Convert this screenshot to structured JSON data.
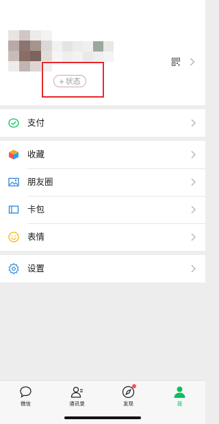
{
  "profile": {
    "status_label": "状态",
    "status_plus": "+",
    "avatar_mosaic": [
      "#e9e4e2",
      "#cfc7c5",
      "#eeeae9",
      "#f5f3f2",
      "#b8aaa7",
      "#8d756f",
      "#a6948f",
      "#dcd6d4",
      "#c9bcb8",
      "#8a6d66",
      "#7d635c",
      "#e2dcd9",
      "#efebea",
      "#c2b5b1",
      "#ddd6d3",
      "#f3f1f0"
    ],
    "name_mosaic": [
      "#f1f1f1",
      "#e4e4e4",
      "#ececec",
      "#f0f0f0",
      "#9aa89d",
      "#e8e8e8",
      "#f5f5f5",
      "#eeeeee",
      "#f2f2f2",
      "#e9e9e9",
      "#efefef",
      "#f4f4f4"
    ]
  },
  "menu": {
    "pay": {
      "label": "支付"
    },
    "favorites": {
      "label": "收藏"
    },
    "moments": {
      "label": "朋友圈"
    },
    "cards": {
      "label": "卡包"
    },
    "stickers": {
      "label": "表情"
    },
    "settings": {
      "label": "设置"
    }
  },
  "tabbar": {
    "chats": "微信",
    "contacts": "通讯录",
    "discover": "发现",
    "me": "我"
  },
  "colors": {
    "accent": "#07c160",
    "highlight": "#e5262a",
    "badge": "#fa5151"
  }
}
